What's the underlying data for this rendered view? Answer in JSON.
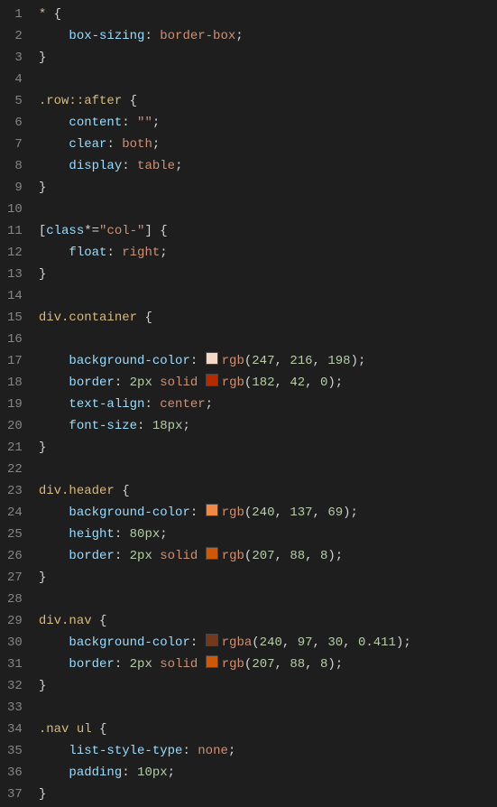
{
  "code": {
    "lines": [
      [
        {
          "t": "* ",
          "c": "tk-selector"
        },
        {
          "t": "{",
          "c": "tk-punct"
        }
      ],
      [
        {
          "t": "    ",
          "c": "tk-punct"
        },
        {
          "t": "box-sizing",
          "c": "tk-prop"
        },
        {
          "t": ": ",
          "c": "tk-punct"
        },
        {
          "t": "border-box",
          "c": "tk-value"
        },
        {
          "t": ";",
          "c": "tk-punct"
        }
      ],
      [
        {
          "t": "}",
          "c": "tk-punct"
        }
      ],
      [],
      [
        {
          "t": ".row::after ",
          "c": "tk-selector"
        },
        {
          "t": "{",
          "c": "tk-punct"
        }
      ],
      [
        {
          "t": "    ",
          "c": "tk-punct"
        },
        {
          "t": "content",
          "c": "tk-prop"
        },
        {
          "t": ": ",
          "c": "tk-punct"
        },
        {
          "t": "\"\"",
          "c": "tk-string"
        },
        {
          "t": ";",
          "c": "tk-punct"
        }
      ],
      [
        {
          "t": "    ",
          "c": "tk-punct"
        },
        {
          "t": "clear",
          "c": "tk-prop"
        },
        {
          "t": ": ",
          "c": "tk-punct"
        },
        {
          "t": "both",
          "c": "tk-value"
        },
        {
          "t": ";",
          "c": "tk-punct"
        }
      ],
      [
        {
          "t": "    ",
          "c": "tk-punct"
        },
        {
          "t": "display",
          "c": "tk-prop"
        },
        {
          "t": ": ",
          "c": "tk-punct"
        },
        {
          "t": "table",
          "c": "tk-value"
        },
        {
          "t": ";",
          "c": "tk-punct"
        }
      ],
      [
        {
          "t": "}",
          "c": "tk-punct"
        }
      ],
      [],
      [
        {
          "t": "[",
          "c": "tk-punct"
        },
        {
          "t": "class",
          "c": "tk-attr"
        },
        {
          "t": "*=",
          "c": "tk-op"
        },
        {
          "t": "\"col-\"",
          "c": "tk-string"
        },
        {
          "t": "] ",
          "c": "tk-punct"
        },
        {
          "t": "{",
          "c": "tk-punct"
        }
      ],
      [
        {
          "t": "    ",
          "c": "tk-punct"
        },
        {
          "t": "float",
          "c": "tk-prop"
        },
        {
          "t": ": ",
          "c": "tk-punct"
        },
        {
          "t": "right",
          "c": "tk-value"
        },
        {
          "t": ";",
          "c": "tk-punct"
        }
      ],
      [
        {
          "t": "}",
          "c": "tk-punct"
        }
      ],
      [],
      [
        {
          "t": "div.container ",
          "c": "tk-selector"
        },
        {
          "t": "{",
          "c": "tk-punct"
        }
      ],
      [],
      [
        {
          "t": "    ",
          "c": "tk-punct"
        },
        {
          "t": "background-color",
          "c": "tk-prop"
        },
        {
          "t": ": ",
          "c": "tk-punct"
        },
        {
          "swatch": "rgb(247,216,198)"
        },
        {
          "t": "rgb",
          "c": "tk-value"
        },
        {
          "t": "(",
          "c": "tk-punct"
        },
        {
          "t": "247",
          "c": "tk-number"
        },
        {
          "t": ", ",
          "c": "tk-punct"
        },
        {
          "t": "216",
          "c": "tk-number"
        },
        {
          "t": ", ",
          "c": "tk-punct"
        },
        {
          "t": "198",
          "c": "tk-number"
        },
        {
          "t": ");",
          "c": "tk-punct"
        }
      ],
      [
        {
          "t": "    ",
          "c": "tk-punct"
        },
        {
          "t": "border",
          "c": "tk-prop"
        },
        {
          "t": ": ",
          "c": "tk-punct"
        },
        {
          "t": "2px",
          "c": "tk-number"
        },
        {
          "t": " ",
          "c": "tk-punct"
        },
        {
          "t": "solid",
          "c": "tk-value"
        },
        {
          "t": " ",
          "c": "tk-punct"
        },
        {
          "swatch": "rgb(182,42,0)"
        },
        {
          "t": "rgb",
          "c": "tk-value"
        },
        {
          "t": "(",
          "c": "tk-punct"
        },
        {
          "t": "182",
          "c": "tk-number"
        },
        {
          "t": ", ",
          "c": "tk-punct"
        },
        {
          "t": "42",
          "c": "tk-number"
        },
        {
          "t": ", ",
          "c": "tk-punct"
        },
        {
          "t": "0",
          "c": "tk-number"
        },
        {
          "t": ");",
          "c": "tk-punct"
        }
      ],
      [
        {
          "t": "    ",
          "c": "tk-punct"
        },
        {
          "t": "text-align",
          "c": "tk-prop"
        },
        {
          "t": ": ",
          "c": "tk-punct"
        },
        {
          "t": "center",
          "c": "tk-value"
        },
        {
          "t": ";",
          "c": "tk-punct"
        }
      ],
      [
        {
          "t": "    ",
          "c": "tk-punct"
        },
        {
          "t": "font-size",
          "c": "tk-prop"
        },
        {
          "t": ": ",
          "c": "tk-punct"
        },
        {
          "t": "18px",
          "c": "tk-number"
        },
        {
          "t": ";",
          "c": "tk-punct"
        }
      ],
      [
        {
          "t": "}",
          "c": "tk-punct"
        }
      ],
      [],
      [
        {
          "t": "div.header ",
          "c": "tk-selector"
        },
        {
          "t": "{",
          "c": "tk-punct"
        }
      ],
      [
        {
          "t": "    ",
          "c": "tk-punct"
        },
        {
          "t": "background-color",
          "c": "tk-prop"
        },
        {
          "t": ": ",
          "c": "tk-punct"
        },
        {
          "swatch": "rgb(240,137,69)"
        },
        {
          "t": "rgb",
          "c": "tk-value"
        },
        {
          "t": "(",
          "c": "tk-punct"
        },
        {
          "t": "240",
          "c": "tk-number"
        },
        {
          "t": ", ",
          "c": "tk-punct"
        },
        {
          "t": "137",
          "c": "tk-number"
        },
        {
          "t": ", ",
          "c": "tk-punct"
        },
        {
          "t": "69",
          "c": "tk-number"
        },
        {
          "t": ");",
          "c": "tk-punct"
        }
      ],
      [
        {
          "t": "    ",
          "c": "tk-punct"
        },
        {
          "t": "height",
          "c": "tk-prop"
        },
        {
          "t": ": ",
          "c": "tk-punct"
        },
        {
          "t": "80px",
          "c": "tk-number"
        },
        {
          "t": ";",
          "c": "tk-punct"
        }
      ],
      [
        {
          "t": "    ",
          "c": "tk-punct"
        },
        {
          "t": "border",
          "c": "tk-prop"
        },
        {
          "t": ": ",
          "c": "tk-punct"
        },
        {
          "t": "2px",
          "c": "tk-number"
        },
        {
          "t": " ",
          "c": "tk-punct"
        },
        {
          "t": "solid",
          "c": "tk-value"
        },
        {
          "t": " ",
          "c": "tk-punct"
        },
        {
          "swatch": "rgb(207,88,8)"
        },
        {
          "t": "rgb",
          "c": "tk-value"
        },
        {
          "t": "(",
          "c": "tk-punct"
        },
        {
          "t": "207",
          "c": "tk-number"
        },
        {
          "t": ", ",
          "c": "tk-punct"
        },
        {
          "t": "88",
          "c": "tk-number"
        },
        {
          "t": ", ",
          "c": "tk-punct"
        },
        {
          "t": "8",
          "c": "tk-number"
        },
        {
          "t": ");",
          "c": "tk-punct"
        }
      ],
      [
        {
          "t": "}",
          "c": "tk-punct"
        }
      ],
      [],
      [
        {
          "t": "div.nav ",
          "c": "tk-selector"
        },
        {
          "t": "{",
          "c": "tk-punct"
        }
      ],
      [
        {
          "t": "    ",
          "c": "tk-punct"
        },
        {
          "t": "background-color",
          "c": "tk-prop"
        },
        {
          "t": ": ",
          "c": "tk-punct"
        },
        {
          "swatch": "rgba(240,97,30,0.411)"
        },
        {
          "t": "rgba",
          "c": "tk-value"
        },
        {
          "t": "(",
          "c": "tk-punct"
        },
        {
          "t": "240",
          "c": "tk-number"
        },
        {
          "t": ", ",
          "c": "tk-punct"
        },
        {
          "t": "97",
          "c": "tk-number"
        },
        {
          "t": ", ",
          "c": "tk-punct"
        },
        {
          "t": "30",
          "c": "tk-number"
        },
        {
          "t": ", ",
          "c": "tk-punct"
        },
        {
          "t": "0.411",
          "c": "tk-number"
        },
        {
          "t": ");",
          "c": "tk-punct"
        }
      ],
      [
        {
          "t": "    ",
          "c": "tk-punct"
        },
        {
          "t": "border",
          "c": "tk-prop"
        },
        {
          "t": ": ",
          "c": "tk-punct"
        },
        {
          "t": "2px",
          "c": "tk-number"
        },
        {
          "t": " ",
          "c": "tk-punct"
        },
        {
          "t": "solid",
          "c": "tk-value"
        },
        {
          "t": " ",
          "c": "tk-punct"
        },
        {
          "swatch": "rgb(207,88,8)"
        },
        {
          "t": "rgb",
          "c": "tk-value"
        },
        {
          "t": "(",
          "c": "tk-punct"
        },
        {
          "t": "207",
          "c": "tk-number"
        },
        {
          "t": ", ",
          "c": "tk-punct"
        },
        {
          "t": "88",
          "c": "tk-number"
        },
        {
          "t": ", ",
          "c": "tk-punct"
        },
        {
          "t": "8",
          "c": "tk-number"
        },
        {
          "t": ");",
          "c": "tk-punct"
        }
      ],
      [
        {
          "t": "}",
          "c": "tk-punct"
        }
      ],
      [],
      [
        {
          "t": ".nav ul ",
          "c": "tk-selector"
        },
        {
          "t": "{",
          "c": "tk-punct"
        }
      ],
      [
        {
          "t": "    ",
          "c": "tk-punct"
        },
        {
          "t": "list-style-type",
          "c": "tk-prop"
        },
        {
          "t": ": ",
          "c": "tk-punct"
        },
        {
          "t": "none",
          "c": "tk-value"
        },
        {
          "t": ";",
          "c": "tk-punct"
        }
      ],
      [
        {
          "t": "    ",
          "c": "tk-punct"
        },
        {
          "t": "padding",
          "c": "tk-prop"
        },
        {
          "t": ": ",
          "c": "tk-punct"
        },
        {
          "t": "10px",
          "c": "tk-number"
        },
        {
          "t": ";",
          "c": "tk-punct"
        }
      ],
      [
        {
          "t": "}",
          "c": "tk-punct"
        }
      ]
    ]
  }
}
